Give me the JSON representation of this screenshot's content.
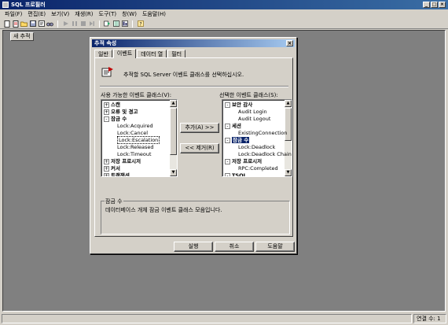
{
  "app": {
    "title": "SQL 프로필러"
  },
  "window_buttons": [
    "_",
    "□",
    "×"
  ],
  "menu": [
    "파일(F)",
    "편집(E)",
    "보기(V)",
    "재생(R)",
    "도구(T)",
    "창(W)",
    "도움말(H)"
  ],
  "toolbar": {
    "icons": [
      "new-icon",
      "new-trace-icon",
      "open-icon",
      "save-icon",
      "properties-icon",
      "find-icon",
      "sep",
      "start-icon",
      "pause-icon",
      "stop-icon",
      "step-icon",
      "sep",
      "replay-icon",
      "query-analyzer-icon",
      "index-tuning-icon",
      "sep",
      "help-icon"
    ]
  },
  "mdi": {
    "new_trace_label": "새 추적"
  },
  "dialog": {
    "title": "추적 속성",
    "close_label": "×",
    "tabs": [
      "일반",
      "이벤트",
      "데이터 열",
      "필터"
    ],
    "info_text": "추적할 SQL Server 이벤트 클래스를 선택하십시오.",
    "available_label": "사용 가능한 이벤트 클래스(V):",
    "selected_label": "선택한 이벤트 클래스(S):",
    "add_button": "추가(A) >>",
    "remove_button": "<< 제거(R)",
    "available_tree": [
      {
        "text": "스캔",
        "exp": "+",
        "level": 0,
        "cat": true
      },
      {
        "text": "오류 및 경고",
        "exp": "+",
        "level": 0,
        "cat": true
      },
      {
        "text": "잠금 수",
        "exp": "−",
        "level": 0,
        "cat": true
      },
      {
        "text": "Lock:Acquired",
        "level": 1
      },
      {
        "text": "Lock:Cancel",
        "level": 1
      },
      {
        "text": "Lock:Escalation",
        "level": 1,
        "focus": true
      },
      {
        "text": "Lock:Released",
        "level": 1
      },
      {
        "text": "Lock:Timeout",
        "level": 1
      },
      {
        "text": "저장 프로시저",
        "exp": "+",
        "level": 0,
        "cat": true
      },
      {
        "text": "커서",
        "exp": "+",
        "level": 0,
        "cat": true
      },
      {
        "text": "트랜잭션",
        "exp": "+",
        "level": 0,
        "cat": true
      }
    ],
    "selected_tree": [
      {
        "text": "보안 감사",
        "exp": "−",
        "level": 0,
        "cat": true
      },
      {
        "text": "Audit Login",
        "level": 1
      },
      {
        "text": "Audit Logout",
        "level": 1
      },
      {
        "text": "세션",
        "exp": "−",
        "level": 0,
        "cat": true
      },
      {
        "text": "ExistingConnection",
        "level": 1
      },
      {
        "text": "잠금 수",
        "exp": "−",
        "level": 0,
        "cat": true,
        "selected": true
      },
      {
        "text": "Lock:Deadlock",
        "level": 1
      },
      {
        "text": "Lock:Deadlock Chain",
        "level": 1
      },
      {
        "text": "저장 프로시저",
        "exp": "−",
        "level": 0,
        "cat": true
      },
      {
        "text": "RPC:Completed",
        "level": 1
      },
      {
        "text": "TSQL",
        "exp": "−",
        "level": 0,
        "cat": true
      }
    ],
    "group_title": "잠금 수",
    "group_desc": "데이터베이스 개체 잠금 이벤트 클래스 모음입니다.",
    "footer": {
      "run": "실행",
      "cancel": "취소",
      "help": "도움말"
    }
  },
  "status": {
    "connections": "연결 수: 1"
  }
}
